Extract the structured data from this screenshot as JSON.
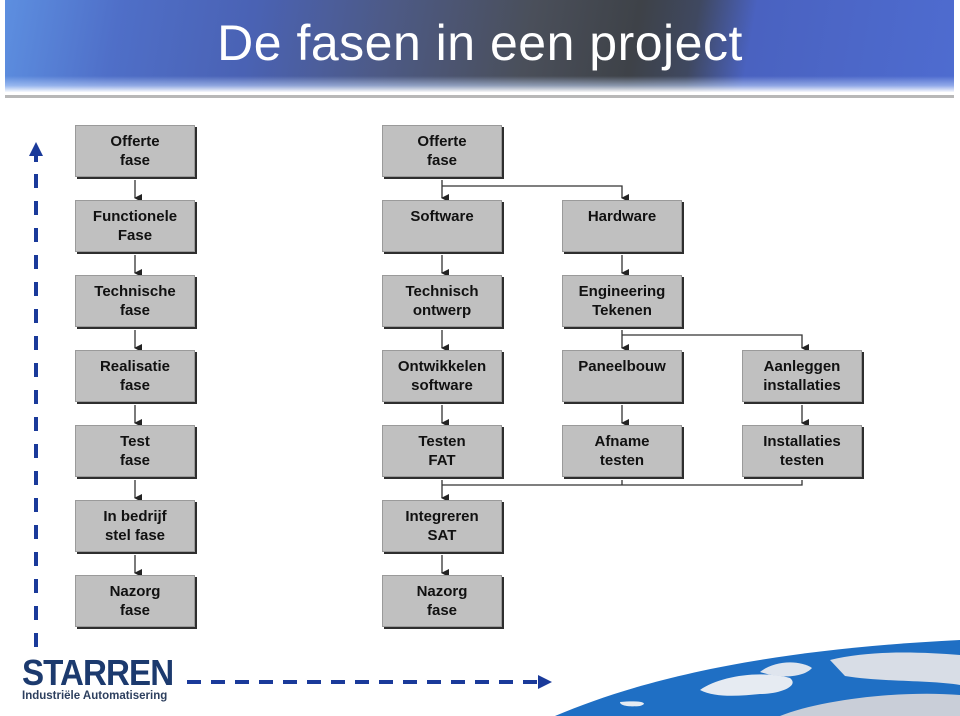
{
  "header": {
    "title": "De fasen in een project"
  },
  "phases_column": [
    {
      "label": "Offerte\nfase"
    },
    {
      "label": "Functionele\nFase"
    },
    {
      "label": "Technische\nfase"
    },
    {
      "label": "Realisatie\nfase"
    },
    {
      "label": "Test\nfase"
    },
    {
      "label": "In bedrijf\nstel fase"
    },
    {
      "label": "Nazorg\nfase"
    }
  ],
  "flow": {
    "offerte": "Offerte\nfase",
    "software": "Software",
    "hardware": "Hardware",
    "technisch_ontwerp": "Technisch\nontwerp",
    "engineering": "Engineering\nTekenen",
    "ontwikkelen": "Ontwikkelen\nsoftware",
    "paneelbouw": "Paneelbouw",
    "aanleggen": "Aanleggen\ninstallaties",
    "testen_fat": "Testen\nFAT",
    "afname": "Afname\ntesten",
    "installaties_testen": "Installaties\ntesten",
    "integreren": "Integreren\nSAT",
    "nazorg": "Nazorg\nfase"
  },
  "logo": {
    "name": "STARREN",
    "tagline": "Industriële Automatisering"
  },
  "colors": {
    "box_fill": "#c0c0c0",
    "arrow_blue": "#1a3a9a",
    "logo_navy": "#1c3a6e"
  }
}
